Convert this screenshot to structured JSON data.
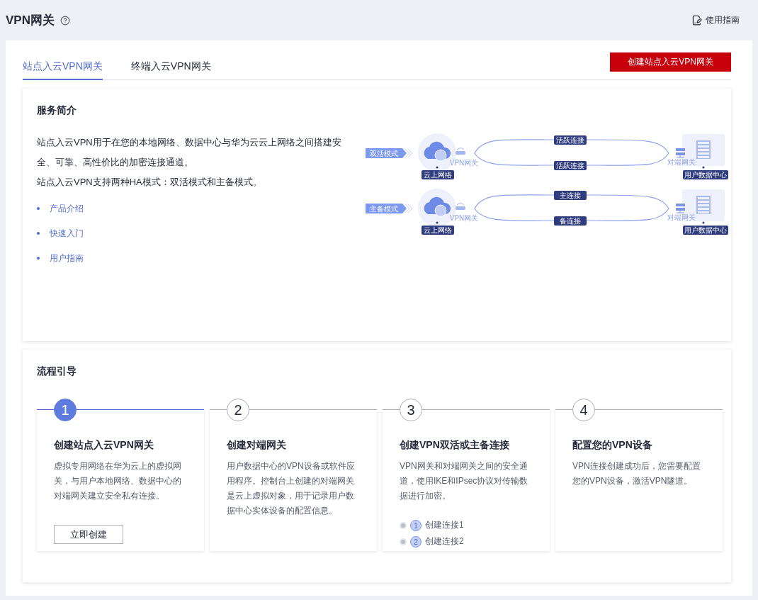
{
  "header": {
    "title": "VPN网关",
    "guide_link": "使用指南"
  },
  "tabs": [
    {
      "label": "站点入云VPN网关",
      "selected": true
    },
    {
      "label": "终端入云VPN网关",
      "selected": false
    }
  ],
  "create_button": "创建站点入云VPN网关",
  "intro": {
    "title": "服务简介",
    "paragraphs": [
      "站点入云VPN用于在您的本地网络、数据中心与华为云云上网络之间搭建安全、可靠、高性价比的加密连接通道。",
      "站点入云VPN支持两种HA模式：双活模式和主备模式。"
    ],
    "links": [
      "产品介绍",
      "快速入门",
      "用户指南"
    ],
    "diagram": [
      {
        "mode": "双活模式",
        "gateway": "VPN网关",
        "cloud": "云上网络",
        "links": [
          "活跃连接",
          "活跃连接"
        ],
        "peer": "对端网关",
        "datacenter": "用户数据中心"
      },
      {
        "mode": "主备模式",
        "gateway": "VPN网关",
        "cloud": "云上网络",
        "links": [
          "主连接",
          "备连接"
        ],
        "peer": "对端网关",
        "datacenter": "用户数据中心"
      }
    ]
  },
  "flow": {
    "title": "流程引导",
    "steps": [
      {
        "number": "1",
        "active": true,
        "title": "创建站点入云VPN网关",
        "text": "虚拟专用网络在华为云上的虚拟网关，与用户本地网络、数据中心的对端网关建立安全私有连接。",
        "button": "立即创建"
      },
      {
        "number": "2",
        "active": false,
        "title": "创建对端网关",
        "text": "用户数据中心的VPN设备或软件应用程序。控制台上创建的对端网关是云上虚拟对象，用于记录用户数据中心实体设备的配置信息。"
      },
      {
        "number": "3",
        "active": false,
        "title": "创建VPN双活或主备连接",
        "text": "VPN网关和对端网关之间的安全通道，使用IKE和IPsec协议对传输数据进行加密。",
        "substeps": [
          {
            "number": "1",
            "label": "创建连接1"
          },
          {
            "number": "2",
            "label": "创建连接2"
          }
        ]
      },
      {
        "number": "4",
        "active": false,
        "title": "配置您的VPN设备",
        "text": "VPN连接创建成功后，您需要配置您的VPN设备，激活VPN隧道。"
      }
    ]
  }
}
